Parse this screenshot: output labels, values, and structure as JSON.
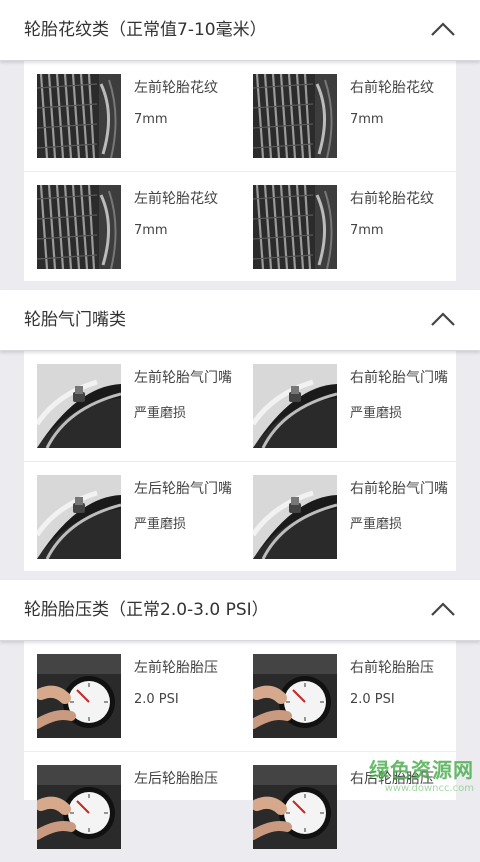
{
  "sections": [
    {
      "title": "轮胎花纹类（正常值7-10毫米）",
      "kind": "tread",
      "rows": [
        [
          {
            "label": "左前轮胎花纹",
            "value": "7mm"
          },
          {
            "label": "右前轮胎花纹",
            "value": "7mm"
          }
        ],
        [
          {
            "label": "左前轮胎花纹",
            "value": "7mm"
          },
          {
            "label": "右前轮胎花纹",
            "value": "7mm"
          }
        ]
      ]
    },
    {
      "title": "轮胎气门嘴类",
      "kind": "valve",
      "rows": [
        [
          {
            "label": "左前轮胎气门嘴",
            "value": "严重磨损"
          },
          {
            "label": "右前轮胎气门嘴",
            "value": "严重磨损"
          }
        ],
        [
          {
            "label": "左后轮胎气门嘴",
            "value": "严重磨损"
          },
          {
            "label": "右前轮胎气门嘴",
            "value": "严重磨损"
          }
        ]
      ]
    },
    {
      "title": "轮胎胎压类（正常2.0-3.0 PSI）",
      "kind": "pressure",
      "rows": [
        [
          {
            "label": "左前轮胎胎压",
            "value": "2.0 PSI"
          },
          {
            "label": "右前轮胎胎压",
            "value": "2.0 PSI"
          }
        ],
        [
          {
            "label": "左后轮胎胎压",
            "value": ""
          },
          {
            "label": "右后轮胎胎压",
            "value": ""
          }
        ]
      ]
    }
  ],
  "watermark": {
    "main": "绿色资源网",
    "sub": "www.downcc.com"
  },
  "icons": {
    "collapse": "chevron-up-icon",
    "tread": "tire-tread-photo",
    "valve": "tire-valve-photo",
    "pressure": "pressure-gauge-photo"
  }
}
